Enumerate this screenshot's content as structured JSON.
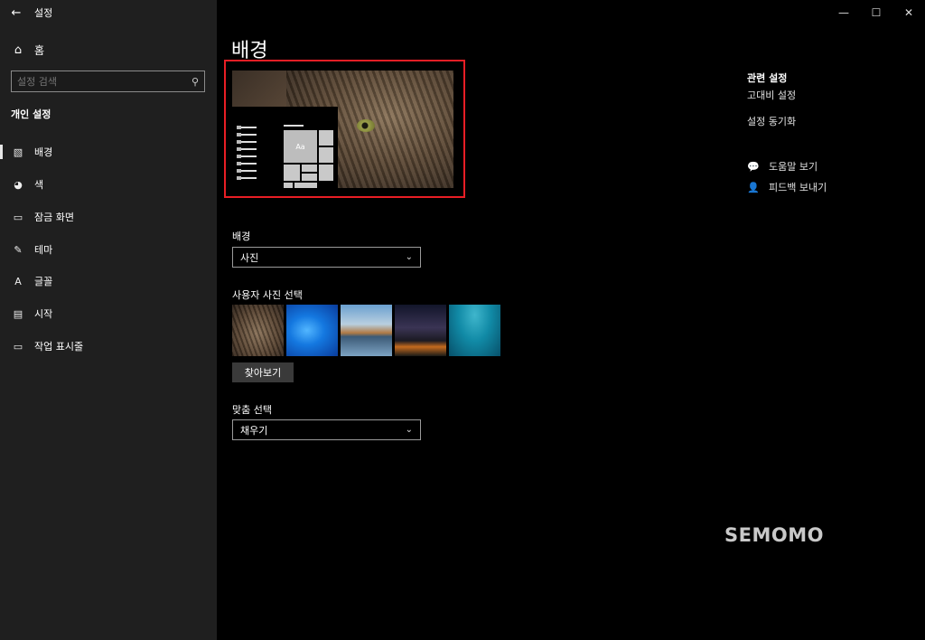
{
  "app": {
    "title": "설정"
  },
  "window_controls": {
    "minimize": "—",
    "maximize": "☐",
    "close": "✕"
  },
  "sidebar": {
    "back_icon": "←",
    "home_label": "홈",
    "search": {
      "placeholder": "설정 검색"
    },
    "section_label": "개인 설정",
    "items": [
      {
        "label": "배경",
        "icon": "picture-icon",
        "glyph": "🖼"
      },
      {
        "label": "색",
        "icon": "palette-icon",
        "glyph": "◕"
      },
      {
        "label": "잠금 화면",
        "icon": "lock-screen-icon",
        "glyph": "▭"
      },
      {
        "label": "테마",
        "icon": "theme-icon",
        "glyph": "✎"
      },
      {
        "label": "글꼴",
        "icon": "font-icon",
        "glyph": "ᴬA"
      },
      {
        "label": "시작",
        "icon": "start-icon",
        "glyph": "▤"
      },
      {
        "label": "작업 표시줄",
        "icon": "taskbar-icon",
        "glyph": "▭"
      }
    ],
    "active_index": 0
  },
  "main": {
    "title": "배경",
    "preview": {
      "sample_text": "Aa",
      "highlight_color": "#e81e25"
    },
    "background": {
      "label": "배경",
      "value": "사진"
    },
    "choose_picture": {
      "label": "사용자 사진 선택",
      "browse_label": "찾아보기"
    },
    "fit": {
      "label": "맞춤 선택",
      "value": "채우기"
    }
  },
  "related": {
    "title": "관련 설정",
    "links": [
      "고대비 설정",
      "설정 동기화"
    ],
    "help": [
      {
        "label": "도움말 보기",
        "icon": "help-icon"
      },
      {
        "label": "피드백 보내기",
        "icon": "feedback-icon"
      }
    ]
  },
  "watermark": "SEMOMO",
  "accent_color": "#e81e25"
}
